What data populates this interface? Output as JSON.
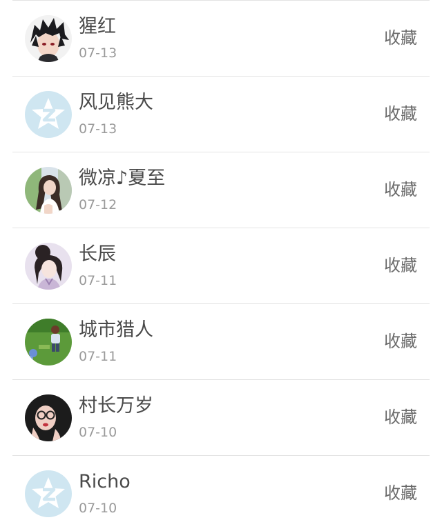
{
  "items": [
    {
      "name": "猩红",
      "date": "07-13",
      "action": "收藏",
      "avatar_icon": "anime-boy-avatar-icon"
    },
    {
      "name": "风见熊大",
      "date": "07-13",
      "action": "收藏",
      "avatar_icon": "qzone-star-avatar-icon"
    },
    {
      "name": "微凉♪夏至",
      "date": "07-12",
      "action": "收藏",
      "avatar_icon": "woman-photo-avatar-icon"
    },
    {
      "name": "长辰",
      "date": "07-11",
      "action": "收藏",
      "avatar_icon": "illustrated-girl-avatar-icon"
    },
    {
      "name": "城市猎人",
      "date": "07-11",
      "action": "收藏",
      "avatar_icon": "child-on-grass-avatar-icon"
    },
    {
      "name": "村长万岁",
      "date": "07-10",
      "action": "收藏",
      "avatar_icon": "girl-glasses-avatar-icon"
    },
    {
      "name": "Richo",
      "date": "07-10",
      "action": "收藏",
      "avatar_icon": "qzone-star-avatar-icon"
    }
  ],
  "colors": {
    "name_text": "#4a4a4a",
    "date_text": "#9a9a9a",
    "action_text": "#6a6a6a",
    "divider": "#e3e3e3",
    "default_avatar_bg": "#cfe6f1"
  }
}
